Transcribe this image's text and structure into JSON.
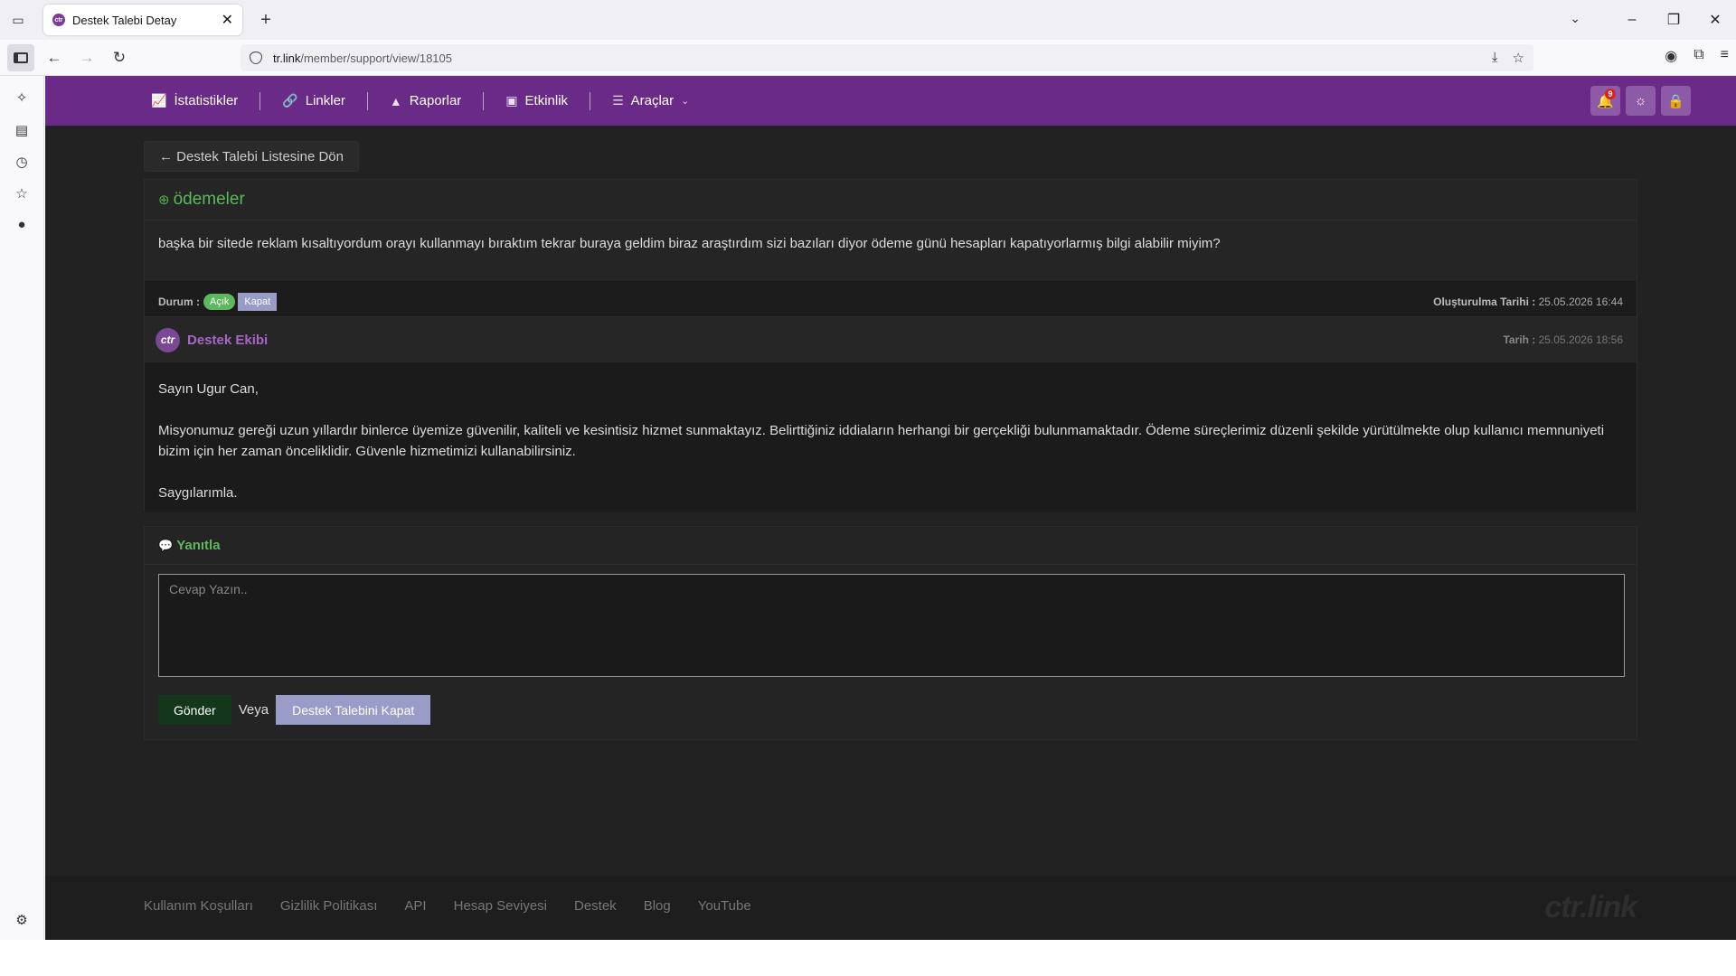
{
  "browser": {
    "tab_title": "Destek Talebi Detay",
    "tab_favicon_text": "ctr",
    "url_host": "tr.link",
    "url_path": "/member/support/view/18105"
  },
  "nav": {
    "items": [
      {
        "label": "İstatistikler",
        "icon": "chart-line-icon"
      },
      {
        "label": "Linkler",
        "icon": "link-icon"
      },
      {
        "label": "Raporlar",
        "icon": "area-chart-icon"
      },
      {
        "label": "Etkinlik",
        "icon": "gift-icon"
      },
      {
        "label": "Araçlar",
        "icon": "sliders-icon"
      }
    ],
    "notification_count": "9"
  },
  "back_link": "← Destek Talebi Listesine Dön",
  "ticket": {
    "title": "ödemeler",
    "message": "başka bir sitede reklam kısaltıyordum orayı kullanmayı bıraktım tekrar buraya geldim biraz araştırdım sizi bazıları diyor ödeme günü hesapları kapatıyorlarmış bilgi alabilir miyim?",
    "status_label": "Durum :",
    "status_open": "Açık",
    "status_close": "Kapat",
    "created_label": "Oluşturulma Tarihi :",
    "created_value": "25.05.2026 16:44"
  },
  "reply": {
    "avatar_text": "ctr",
    "author": "Destek Ekibi",
    "date_label": "Tarih :",
    "date_value": "25.05.2026 18:56",
    "greeting": "Sayın Ugur Can,",
    "body": "Misyonumuz gereği uzun yıllardır binlerce üyemize güvenilir, kaliteli ve kesintisiz hizmet sunmaktayız. Belirttiğiniz iddiaların herhangi bir gerçekliği bulunmamaktadır. Ödeme süreçlerimiz düzenli şekilde yürütülmekte olup kullanıcı memnuniyeti bizim için her zaman önceliklidir. Güvenle hizmetimizi kullanabilirsiniz.",
    "closing": "Saygılarımla."
  },
  "respond": {
    "title": "Yanıtla",
    "placeholder": "Cevap Yazın..",
    "send": "Gönder",
    "or": "Veya",
    "close": "Destek Talebini Kapat"
  },
  "footer": {
    "links": [
      "Kullanım Koşulları",
      "Gizlilik Politikası",
      "API",
      "Hesap Seviyesi",
      "Destek",
      "Blog",
      "YouTube"
    ],
    "logo": "ctr.link"
  },
  "colors": {
    "brand_purple": "#6a2a87",
    "accent_green": "#5cb85c",
    "close_lavender": "#9a9cc8"
  }
}
